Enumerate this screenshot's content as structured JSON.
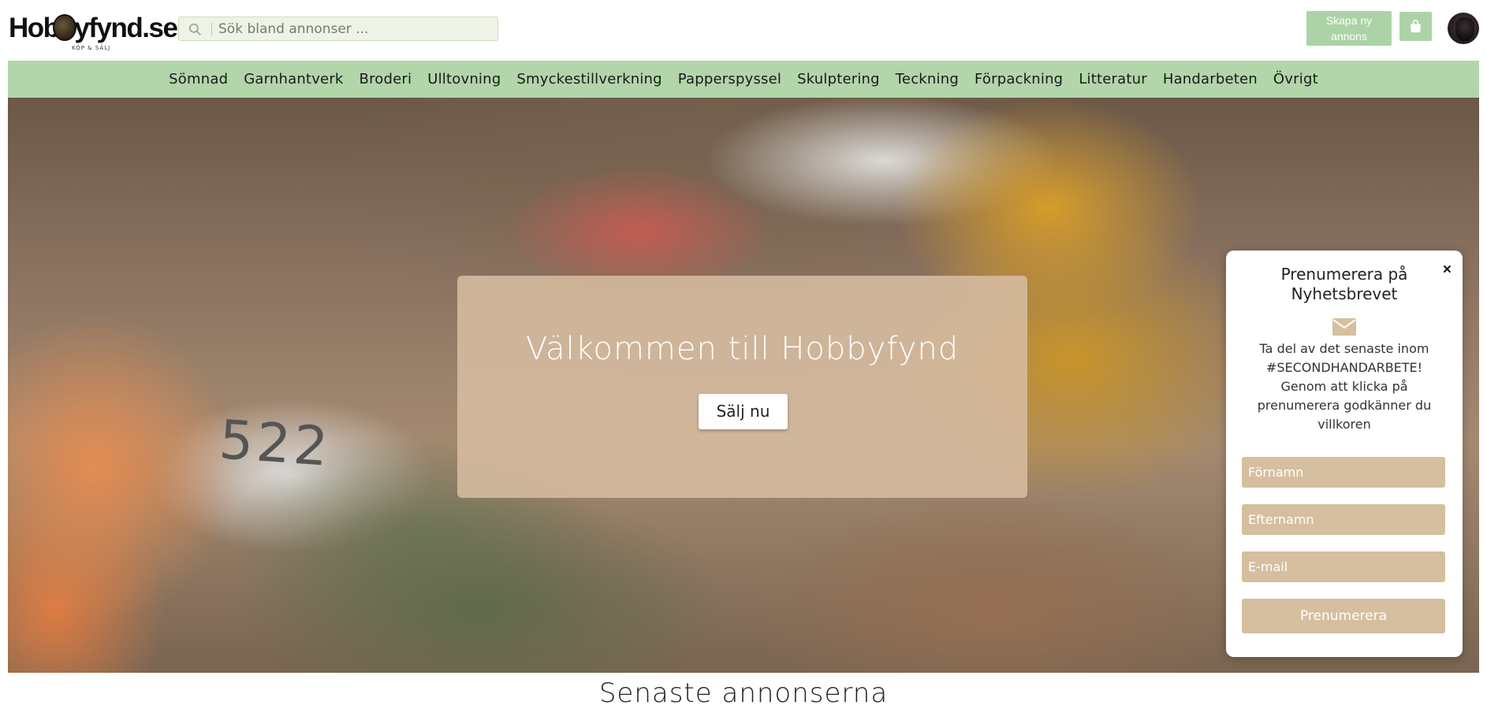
{
  "header": {
    "logo_text": "Hobbyfynd.se",
    "logo_sub": "KÖP & SÄLJ",
    "search_placeholder": "Sök bland annonser ...",
    "create_ad_label": "Skapa ny annons",
    "cart_icon": "shopping-bag-icon",
    "search_icon": "search-icon"
  },
  "nav": {
    "items": [
      "Sömnad",
      "Garnhantverk",
      "Broderi",
      "Ulltovning",
      "Smyckestillverkning",
      "Papperspyssel",
      "Skulptering",
      "Teckning",
      "Förpackning",
      "Litteratur",
      "Handarbeten",
      "Övrigt"
    ]
  },
  "hero": {
    "title": "Välkommen till Hobbyfynd",
    "button_label": "Sälj nu",
    "spool_number": "522"
  },
  "newsletter": {
    "close_label": "×",
    "title": "Prenumerera på Nyhetsbrevet",
    "icon": "envelope-icon",
    "text": "Ta del av det senaste inom #SECONDHANDARBETE! Genom att klicka på prenumerera godkänner du villkoren",
    "first_name_placeholder": "Förnamn",
    "last_name_placeholder": "Efternamn",
    "email_placeholder": "E-mail",
    "submit_label": "Prenumerera"
  },
  "latest": {
    "heading": "Senaste annonserna"
  },
  "colors": {
    "nav_bg": "#b2d5a9",
    "button_green": "#abd3a5",
    "field_beige": "#d5bf9e",
    "hero_card": "#d6bca0"
  }
}
